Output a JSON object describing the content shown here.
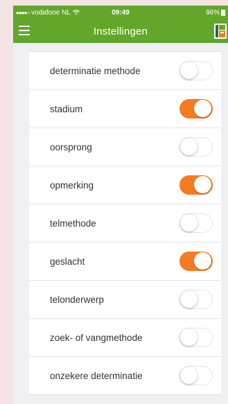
{
  "status_bar": {
    "carrier": "vodafone NL",
    "signal": "●●●●○",
    "wifi_icon": "wifi-icon",
    "time": "09:49",
    "battery": "96%"
  },
  "nav": {
    "title": "Instellingen",
    "menu_icon": "hamburger-menu-icon",
    "logo_icon": "app-logo-icon"
  },
  "colors": {
    "header_green": "#62a72a",
    "switch_on": "#f47b22",
    "background": "#efeff4"
  },
  "settings": [
    {
      "label": "determinatie methode",
      "enabled": false
    },
    {
      "label": "stadium",
      "enabled": true
    },
    {
      "label": "oorsprong",
      "enabled": false
    },
    {
      "label": "opmerking",
      "enabled": true
    },
    {
      "label": "telmethode",
      "enabled": false
    },
    {
      "label": "geslacht",
      "enabled": true
    },
    {
      "label": "telonderwerp",
      "enabled": false
    },
    {
      "label": "zoek- of vangmethode",
      "enabled": false
    },
    {
      "label": "onzekere determinatie",
      "enabled": false
    }
  ]
}
